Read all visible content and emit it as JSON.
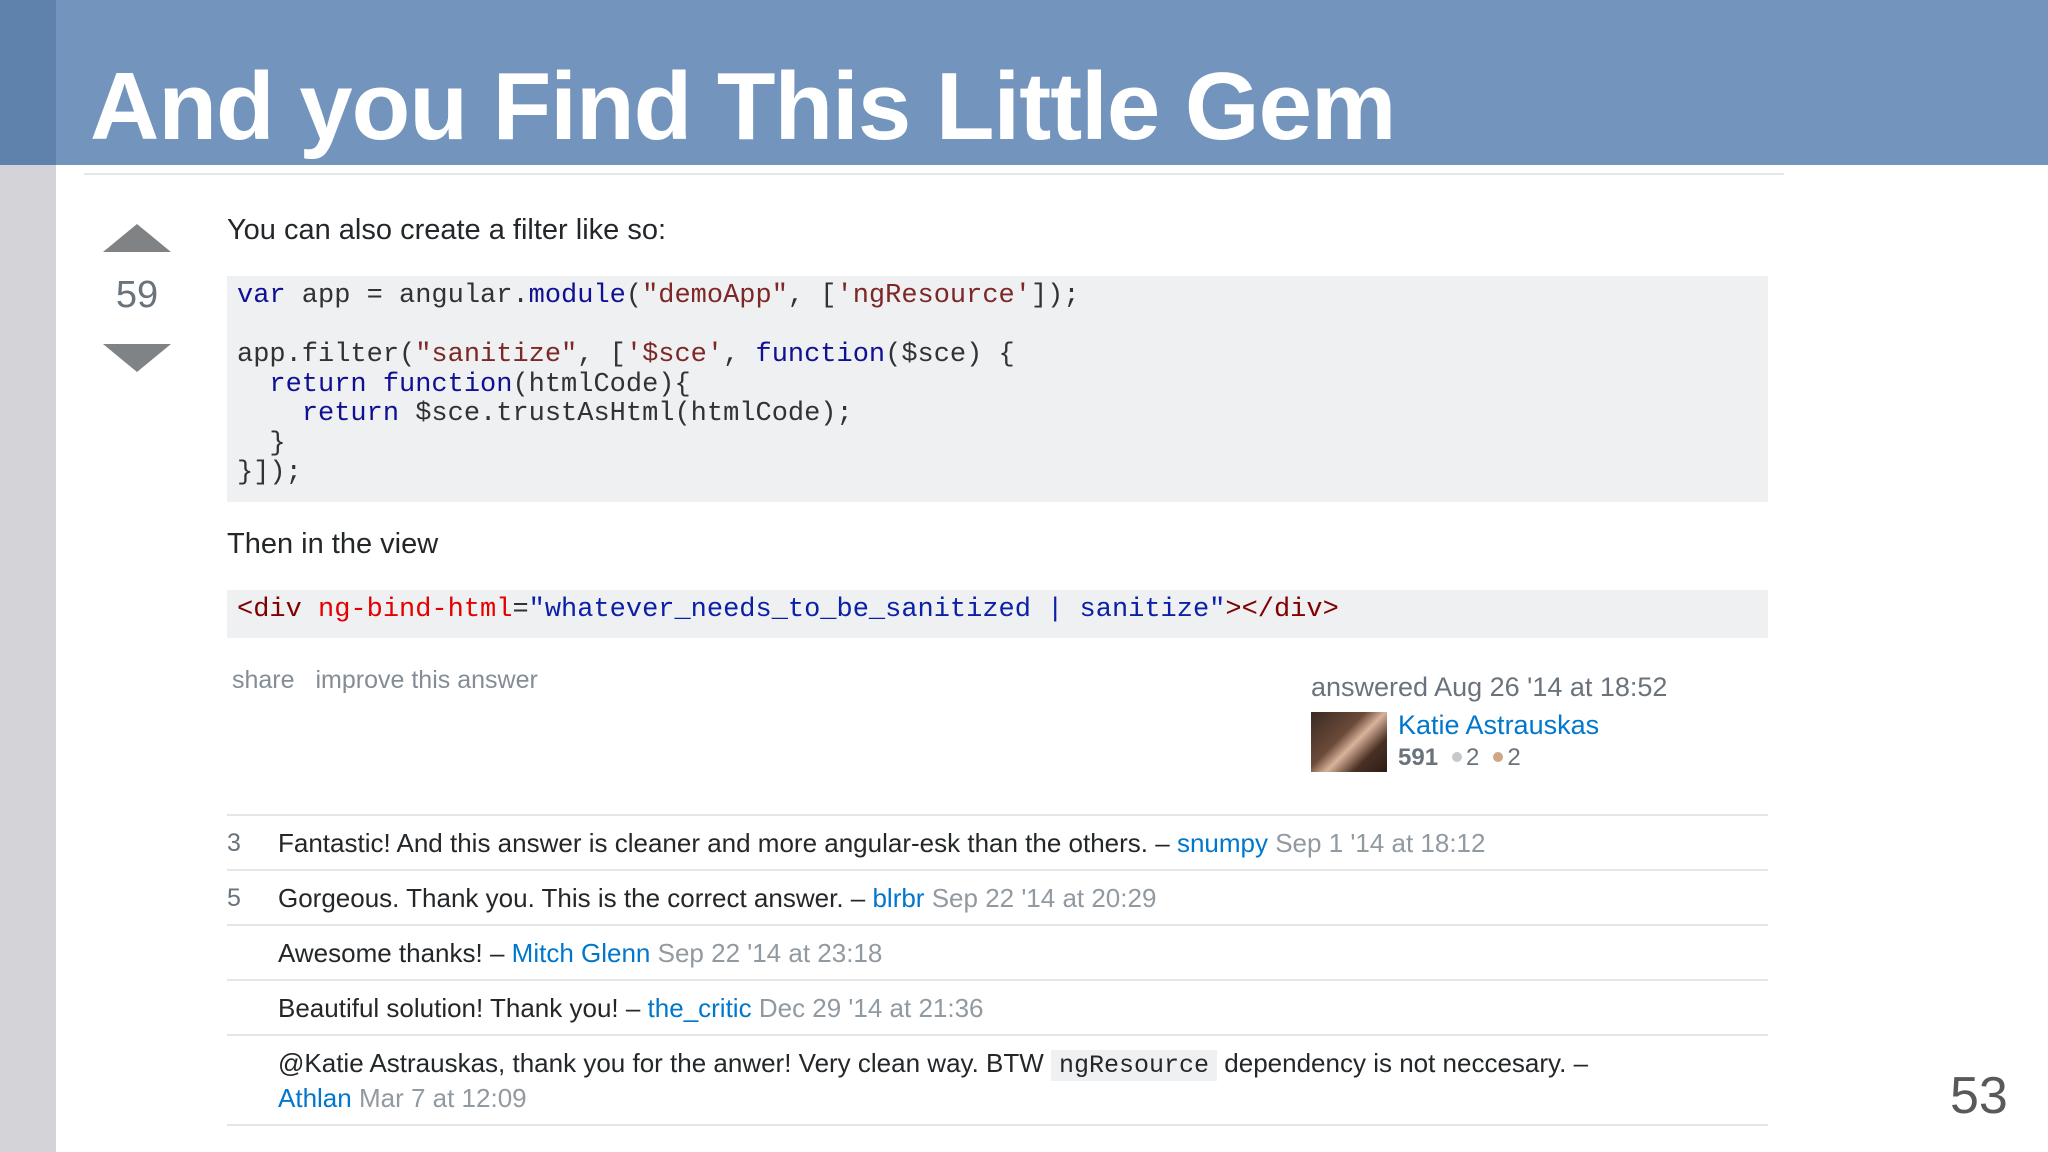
{
  "slide": {
    "title": "And you Find This Little Gem",
    "page_number": "53"
  },
  "answer": {
    "vote_count": "59",
    "intro_text": "You can also create a filter like so:",
    "view_text": "Then in the view",
    "code_js": {
      "l1_var": "var",
      "l1_rest": " app = angular.",
      "l1_module": "module",
      "l1_paren": "(",
      "l1_str1": "\"demoApp\"",
      "l1_comma": ", [",
      "l1_str2": "'ngResource'",
      "l1_end": "]);",
      "l3_a": "app.filter(",
      "l3_str1": "\"sanitize\"",
      "l3_b": ", [",
      "l3_str2": "'$sce'",
      "l3_c": ", ",
      "l3_fn": "function",
      "l3_d": "($sce) {",
      "l4_ret": "return",
      "l4_fn": "function",
      "l4_rest": "(htmlCode){",
      "l5_ret": "return",
      "l5_rest": " $sce.trustAsHtml(htmlCode);",
      "l6": "  }",
      "l7": "}]);"
    },
    "code_html": {
      "open_tag": "<div",
      "attr": "ng-bind-html",
      "eq": "=",
      "value": "\"whatever_needs_to_be_sanitized | sanitize\"",
      "close_tag": "></div>"
    },
    "menu": {
      "share": "share",
      "improve": "improve this answer"
    },
    "signature": {
      "answered": "answered Aug 26 '14 at 18:52",
      "user_name": "Katie Astrauskas",
      "reputation": "591",
      "silver_badges": "2",
      "bronze_badges": "2",
      "silver_color": "#c5c9cb",
      "bronze_color": "#d1a684"
    }
  },
  "comments": [
    {
      "score": "3",
      "text": "Fantastic! And this answer is cleaner and more angular-esk than the others. – ",
      "user": "snumpy",
      "date": "Sep 1 '14 at 18:12"
    },
    {
      "score": "5",
      "text": "Gorgeous. Thank you. This is the correct answer. – ",
      "user": "blrbr",
      "date": "Sep 22 '14 at 20:29"
    },
    {
      "score": "",
      "text": "Awesome thanks! – ",
      "user": "Mitch Glenn",
      "date": "Sep 22 '14 at 23:18"
    },
    {
      "score": "",
      "text": "Beautiful solution! Thank you! – ",
      "user": "the_critic",
      "date": "Dec 29 '14 at 21:36"
    },
    {
      "score": "",
      "text_before": "@Katie Astrauskas, thank you for the anwer! Very clean way. BTW ",
      "code": "ngResource",
      "text_after": " dependency is not neccesary. – ",
      "user": "Athlan",
      "date": "Mar 7 at 12:09"
    }
  ]
}
